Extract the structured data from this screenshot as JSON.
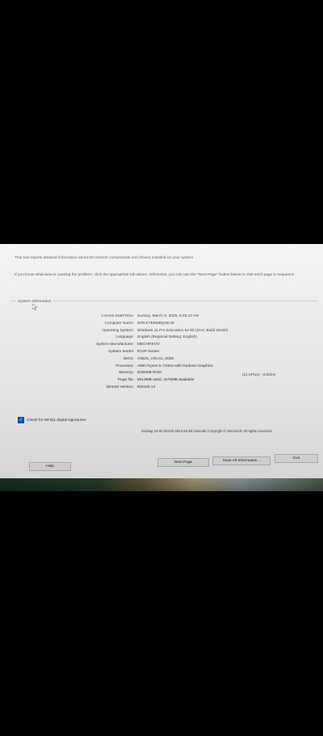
{
  "dialog": {
    "intro_text": "This tool reports detailed information about the DirectX components and drivers installed on your system.",
    "intro_text_2": "If you know what area is causing the problem, click the appropriate tab above. Otherwise, you can use the \"Next Page\" button below to visit each page in sequence.",
    "group_title": "System Information",
    "info": [
      {
        "label": "Current Date/Time:",
        "value": "Sunday, March 8, 2026, 9:25:13 AM"
      },
      {
        "label": "Computer Name:",
        "value": "WIN-K7EM2BQHDJ9"
      },
      {
        "label": "Operating System:",
        "value": "Windows 11 Pro Education 64-bit (10.0, Build 26100)"
      },
      {
        "label": "Language:",
        "value": "English (Regional Setting: English)"
      },
      {
        "label": "System Manufacturer:",
        "value": "MECHREVO"
      },
      {
        "label": "System Model:",
        "value": "R14P Series"
      },
      {
        "label": "BIOS:",
        "value": "A0525_V00.01_0005"
      },
      {
        "label": "Processor:",
        "value": "AMD Ryzen 5 7430U with Radeon Graphics"
      },
      {
        "label": "Memory:",
        "value": "8192MB RAM"
      },
      {
        "label": "Page file:",
        "value": "5013MB used, 4475MB available"
      },
      {
        "label": "DirectX Version:",
        "value": "DirectX 12"
      }
    ],
    "processor_extra": "(12 CPUs), ~2.3GHz",
    "whql_label": "Check for WHQL digital signatures",
    "whql_checked": true,
    "footer_text": "DxDiag 10.00.26100.3624 64-bit Unicode  Copyright © Microsoft. All rights reserved.",
    "buttons": {
      "help": "Help",
      "next_page": "Next Page",
      "save_all": "Save All Information...",
      "exit": "Exit"
    }
  }
}
